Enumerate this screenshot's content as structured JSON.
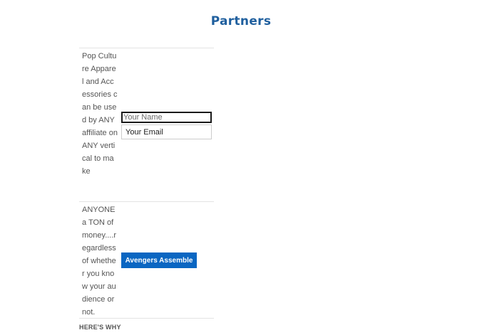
{
  "page": {
    "title": "Partners"
  },
  "rows": [
    {
      "text": "Pop Culture Apparel and Accessories can be used by ANY affiliate on ANY vertical to make"
    },
    {
      "text": "ANYONE a TON of money....regardless of whether you know your audience or not."
    }
  ],
  "form": {
    "name_placeholder": "Your Name",
    "email_placeholder": "Your Email",
    "submit_label": "Avengers Assemble"
  },
  "footer": {
    "heading": "HERE'S WHY"
  },
  "colors": {
    "title": "#1f5f9e",
    "button": "#0a66c2",
    "body_text": "#555555"
  }
}
